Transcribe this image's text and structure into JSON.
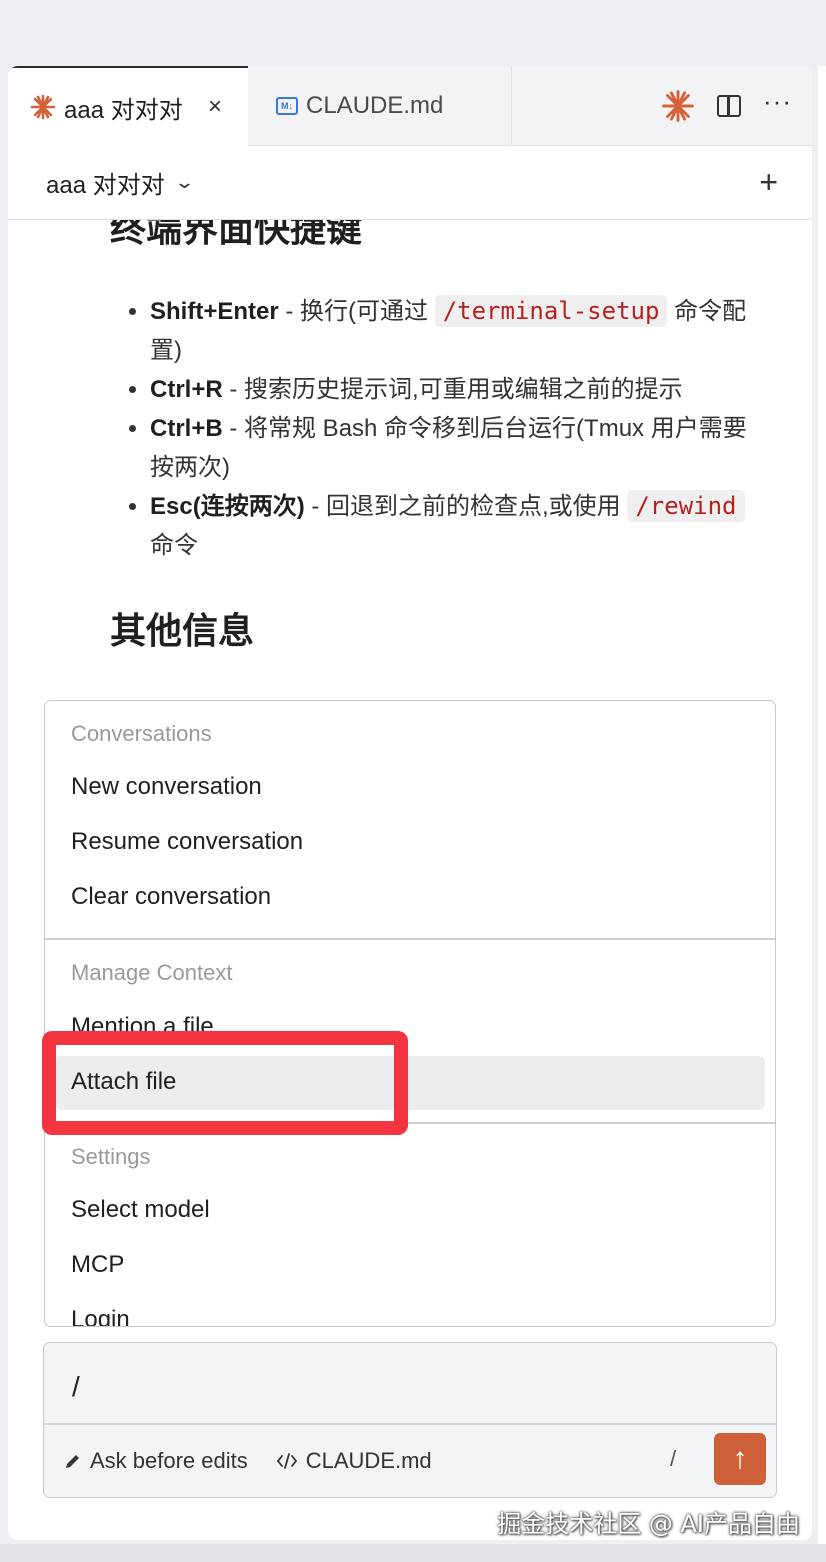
{
  "tabs": [
    {
      "label": "aaa 对对对",
      "icon": "claude-spark-icon",
      "close": "×"
    },
    {
      "label": "CLAUDE.md",
      "icon": "markdown-file-icon",
      "icon_text": "M↓"
    }
  ],
  "tab_actions": {
    "spark": "✳",
    "more": "···"
  },
  "session": {
    "title": "aaa 对对对",
    "chevron": "⌄",
    "new_label": "+"
  },
  "content": {
    "heading1": "终端界面快捷键",
    "bullets": [
      {
        "key": "Shift+Enter",
        "text_before": " - 换行(可通过 ",
        "code": "/terminal-setup",
        "text_after": " 命令配置)"
      },
      {
        "key": "Ctrl+R",
        "text": " - 搜索历史提示词,可重用或编辑之前的提示"
      },
      {
        "key": "Ctrl+B",
        "text": " - 将常规 Bash 命令移到后台运行(Tmux 用户需要按两次)"
      },
      {
        "key": "Esc(连按两次)",
        "text_before": " - 回退到之前的检查点,或使用 ",
        "code": "/rewind",
        "text_after": " 命令"
      }
    ],
    "heading2": "其他信息"
  },
  "menu": {
    "groups": [
      {
        "title": "Conversations",
        "items": [
          "New conversation",
          "Resume conversation",
          "Clear conversation"
        ]
      },
      {
        "title": "Manage Context",
        "items": [
          "Mention a file",
          "Attach file"
        ]
      },
      {
        "title": "Settings",
        "items": [
          "Select model",
          "MCP",
          "Login"
        ]
      }
    ],
    "highlighted": "Attach file"
  },
  "input": {
    "value": "/",
    "mode_label": "Ask before edits",
    "context_file": "CLAUDE.md",
    "slash_hint": "/",
    "send_icon": "↑"
  },
  "watermark": "掘金技术社区 @ AI产品自由",
  "colors": {
    "accent": "#d4613a",
    "highlight": "#f4343e",
    "code": "#b5221f"
  }
}
